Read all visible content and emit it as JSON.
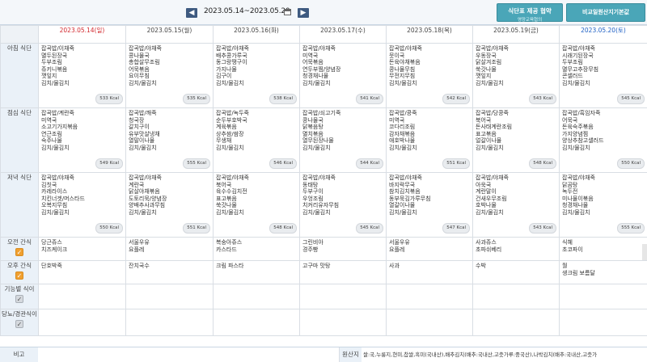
{
  "header": {
    "prev_icon": "◀",
    "next_icon": "▶",
    "week_range": "2023.05.14~2023.05.20",
    "menu_button_line1": "식단표 제공 협약",
    "menu_button_line2": "영양교육협의",
    "compare_button": "비교일원산지기본값"
  },
  "days": [
    "2023.05.14(일)",
    "2023.05.15(월)",
    "2023.05.16(화)",
    "2023.05.17(수)",
    "2023.05.18(목)",
    "2023.05.19(금)",
    "2023.05.20(토)"
  ],
  "rows": {
    "breakfast": "아침 식단",
    "lunch": "점심 식단",
    "dinner": "저녁 식단",
    "am_snack": "오전 간식",
    "pm_snack": "오후 간식",
    "special": "기능별 식이",
    "diabetic": "당뇨/경관식이"
  },
  "breakfast": [
    {
      "items": [
        "잡곡밥/이채죽",
        "멸두된장국",
        "두부조림",
        "쥬키니볶음",
        "깻잎지",
        "김치/물김치"
      ],
      "kcal": "533 Kcal"
    },
    {
      "items": [
        "잡곡밥/야채죽",
        "콩나물국",
        "총합살무조림",
        "어묵볶음",
        "요이무침",
        "김치/물김치"
      ],
      "kcal": "535 Kcal"
    },
    {
      "items": [
        "잡곡밥/야채죽",
        "배추콩가루국",
        "동그랑땡구이",
        "가지나물",
        "김구이",
        "김치/물김치"
      ],
      "kcal": "538 Kcal"
    },
    {
      "items": [
        "잡곡밥/야채죽",
        "미역국",
        "어묵볶음",
        "연두부찜/양념장",
        "청경채나물",
        "김치/물김치"
      ],
      "kcal": "541 Kcal"
    },
    {
      "items": [
        "잡곡밥/야채죽",
        "뭇이국",
        "돈육야채볶음",
        "콩나물무침",
        "무전지무침",
        "김치/물김치"
      ],
      "kcal": "542 Kcal"
    },
    {
      "items": [
        "잡곡밥/야채죽",
        "우동장국",
        "닭살겨조림",
        "쑥갓나물",
        "깻잎지",
        "김치/물김치"
      ],
      "kcal": "543 Kcal"
    },
    {
      "items": [
        "잡곡밥/야채죽",
        "시래기된장국",
        "두부조림",
        "멸무고추장무침",
        "콘샐러드",
        "김치/물김치"
      ],
      "kcal": "545 Kcal"
    }
  ],
  "lunch": [
    {
      "items": [
        "잡곡밥/계란죽",
        "미역국",
        "소고기가지볶음",
        "연근조림",
        "숙주나물",
        "김치/물김치"
      ],
      "kcal": "549 Kcal"
    },
    {
      "items": [
        "잡곡밥/깨죽",
        "청국장",
        "갈치구이",
        "유부맛살냉채",
        "열말이나물",
        "김치/물김치"
      ],
      "kcal": "555 Kcal"
    },
    {
      "items": [
        "잡곡밥/녹두죽",
        "순두부호박국",
        "계육볶음",
        "상추쌈/쌈장",
        "무생채",
        "김치/물김치"
      ],
      "kcal": "546 Kcal"
    },
    {
      "items": [
        "잡곡밥/쇠고기죽",
        "콩나물국",
        "닭볶음탕",
        "멸치볶음",
        "열무된장나물",
        "김치/물김치"
      ],
      "kcal": "544 Kcal"
    },
    {
      "items": [
        "잡곡밥/콩죽",
        "미역국",
        "코다리조림",
        "감자채볶음",
        "애호박나물",
        "김치/물김치"
      ],
      "kcal": "551 Kcal"
    },
    {
      "items": [
        "잡곡밥/당콩죽",
        "북어국",
        "돈사태계란조림",
        "표고볶음",
        "얼갈이나물",
        "김치/물김치"
      ],
      "kcal": "548 Kcal"
    },
    {
      "items": [
        "잡곡밥/흑임자죽",
        "어묵국",
        "돈육숙주볶음",
        "가지양념찜",
        "양상추참고샐러드",
        "김치/물김치"
      ],
      "kcal": "550 Kcal"
    }
  ],
  "dinner": [
    {
      "items": [
        "잡곡밥/야채죽",
        "김칫국",
        "카레라이스",
        "치킨너겟/머스타드",
        "오복지무침",
        "김치/물김치"
      ],
      "kcal": "550 Kcal"
    },
    {
      "items": [
        "잡곡밥/야채죽",
        "계란국",
        "닭살야채볶음",
        "도토리묵/양념장",
        "양배추사과무침",
        "김치/물김치"
      ],
      "kcal": "551 Kcal"
    },
    {
      "items": [
        "잡곡밥/야채죽",
        "북어국",
        "육수수김치전",
        "표고볶음",
        "쑥갓나물",
        "김치/물김치"
      ],
      "kcal": "548 Kcal"
    },
    {
      "items": [
        "잡곡밥/야채죽",
        "동태탕",
        "두부구이",
        "우엉조림",
        "치커리유자무침",
        "김치/물김치"
      ],
      "kcal": "545 Kcal"
    },
    {
      "items": [
        "잡곡밥/야채죽",
        "바지락무국",
        "참치김치볶음",
        "동부묵김가루무침",
        "열갈이나물",
        "김치/물김치"
      ],
      "kcal": "547 Kcal"
    },
    {
      "items": [
        "잡곡밥/야채죽",
        "아욱국",
        "계란말이",
        "건새우무조림",
        "호박나물",
        "김치/물김치"
      ],
      "kcal": "543 Kcal"
    },
    {
      "items": [
        "잡곡밥/야채죽",
        "닭곰탕",
        "녹두전",
        "미나물이볶음",
        "청경채나물",
        "김치/물김치"
      ],
      "kcal": "555 Kcal"
    }
  ],
  "am_snack": [
    [
      "당근쥬스",
      "치즈케이크"
    ],
    [
      "서울우유",
      "요플레"
    ],
    [
      "복숭아쥬스",
      "카스타드"
    ],
    [
      "그린비아",
      "경주빵"
    ],
    [
      "서울우유",
      "요플레"
    ],
    [
      "사과쥬스",
      "초파쉬베리"
    ],
    [
      "식혜",
      "초코파이"
    ]
  ],
  "pm_snack": [
    [
      "단호박죽"
    ],
    [
      "잔치국수"
    ],
    [
      "크림 파스타"
    ],
    [
      "고구마 맛탕"
    ],
    [
      "사과"
    ],
    [
      "수박"
    ],
    [
      "월",
      "생크림 보름달"
    ]
  ],
  "footer": {
    "note_label": "비고",
    "origin_label": "원산지",
    "origin_text": "쌀:국,누룽지,현미,찹쌀,흑미(국내산),배추김치(배추:국내산,고춧가루:중국산),나박김치(배추:국내산,고춧가"
  },
  "colors": {
    "sunday": "#d2282e",
    "saturday": "#1d5fc4",
    "accent": "#4aa6b8",
    "checkbox_on": "#f0a030"
  }
}
